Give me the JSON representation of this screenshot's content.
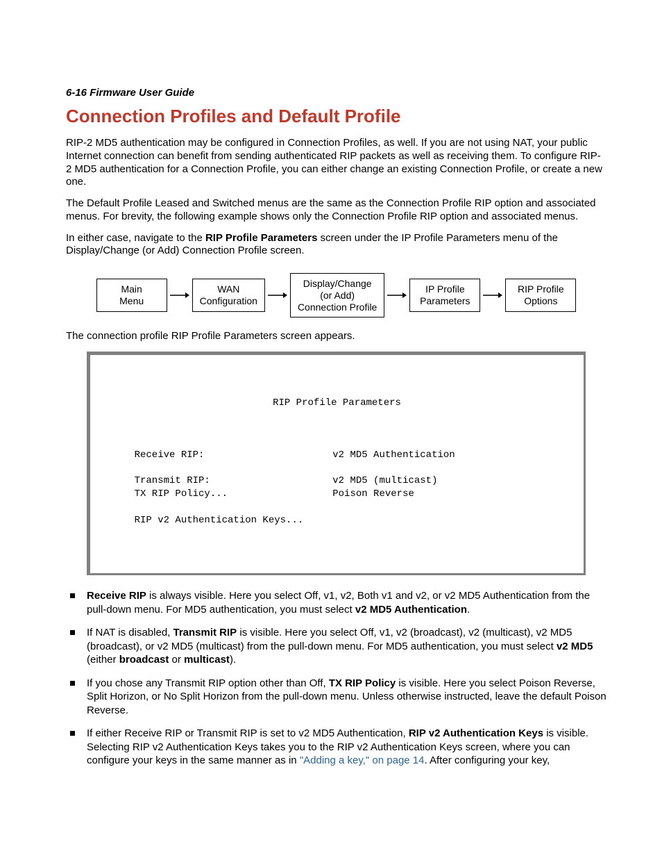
{
  "runhead": "6-16  Firmware User Guide",
  "title": "Connection Profiles and Default Profile",
  "para1": "RIP-2 MD5 authentication may be configured in Connection Profiles, as well. If you are not using NAT, your public Internet connection can benefit from sending authenticated RIP packets as well as receiving them. To configure RIP-2 MD5 authentication for a Connection Profile, you can either change an existing Connection Profile, or create a new one.",
  "para2": "The Default Profile Leased and Switched menus are the same as the Connection Profile RIP option and associated menus. For brevity, the following example shows only the Connection Profile RIP option and associated menus.",
  "para3_a": "In either case, navigate to the ",
  "para3_bold": "RIP Profile Parameters",
  "para3_b": " screen under the IP Profile Parameters menu of the Display/Change (or Add) Connection Profile screen.",
  "flow": {
    "b1": "Main\nMenu",
    "b2": "WAN\nConfiguration",
    "b3": "Display/Change\n(or Add)\nConnection Profile",
    "b4": "IP Profile\nParameters",
    "b5": "RIP Profile\nOptions"
  },
  "para4": "The connection profile RIP Profile Parameters screen appears.",
  "terminal": {
    "title": "RIP Profile Parameters",
    "rows": [
      {
        "label": "Receive RIP:",
        "value": "v2 MD5 Authentication"
      },
      {
        "label": "",
        "value": ""
      },
      {
        "label": "Transmit RIP:",
        "value": "v2 MD5 (multicast)"
      },
      {
        "label": "TX RIP Policy...",
        "value": "Poison Reverse"
      },
      {
        "label": "",
        "value": ""
      },
      {
        "label": "RIP v2 Authentication Keys...",
        "value": ""
      }
    ]
  },
  "bullets": {
    "b1": {
      "t1": "Receive RIP",
      "t2": " is always visible. Here you select Off, v1, v2, Both v1 and v2, or v2 MD5 Authentication from the pull-down menu. For MD5 authentication, you must select ",
      "t3": "v2 MD5 Authentication",
      "t4": "."
    },
    "b2": {
      "t1": "If NAT is disabled, ",
      "t2": "Transmit RIP",
      "t3": " is visible. Here you select Off, v1, v2 (broadcast), v2 (multicast), v2 MD5 (broadcast), or v2 MD5 (multicast) from the pull-down menu. For MD5 authentication, you must select ",
      "t4": "v2 MD5",
      "t5": " (either ",
      "t6": "broadcast",
      "t7": " or ",
      "t8": "multicast",
      "t9": ")."
    },
    "b3": {
      "t1": "If you chose any Transmit RIP option other than Off, ",
      "t2": "TX RIP Policy",
      "t3": " is visible. Here you select Poison Reverse, Split Horizon, or No Split Horizon from the pull-down menu. Unless otherwise instructed, leave the default Poison Reverse."
    },
    "b4": {
      "t1": "If either Receive RIP or Transmit RIP is set to v2 MD5 Authentication, ",
      "t2": "RIP v2 Authentication Keys",
      "t3": " is visible. Selecting RIP v2 Authentication Keys takes you to the RIP v2 Authentication Keys screen, where you can configure your keys in the same manner as in ",
      "t4": "\"Adding a key,\" on page 14",
      "t5": ". After configuring your key,"
    }
  }
}
